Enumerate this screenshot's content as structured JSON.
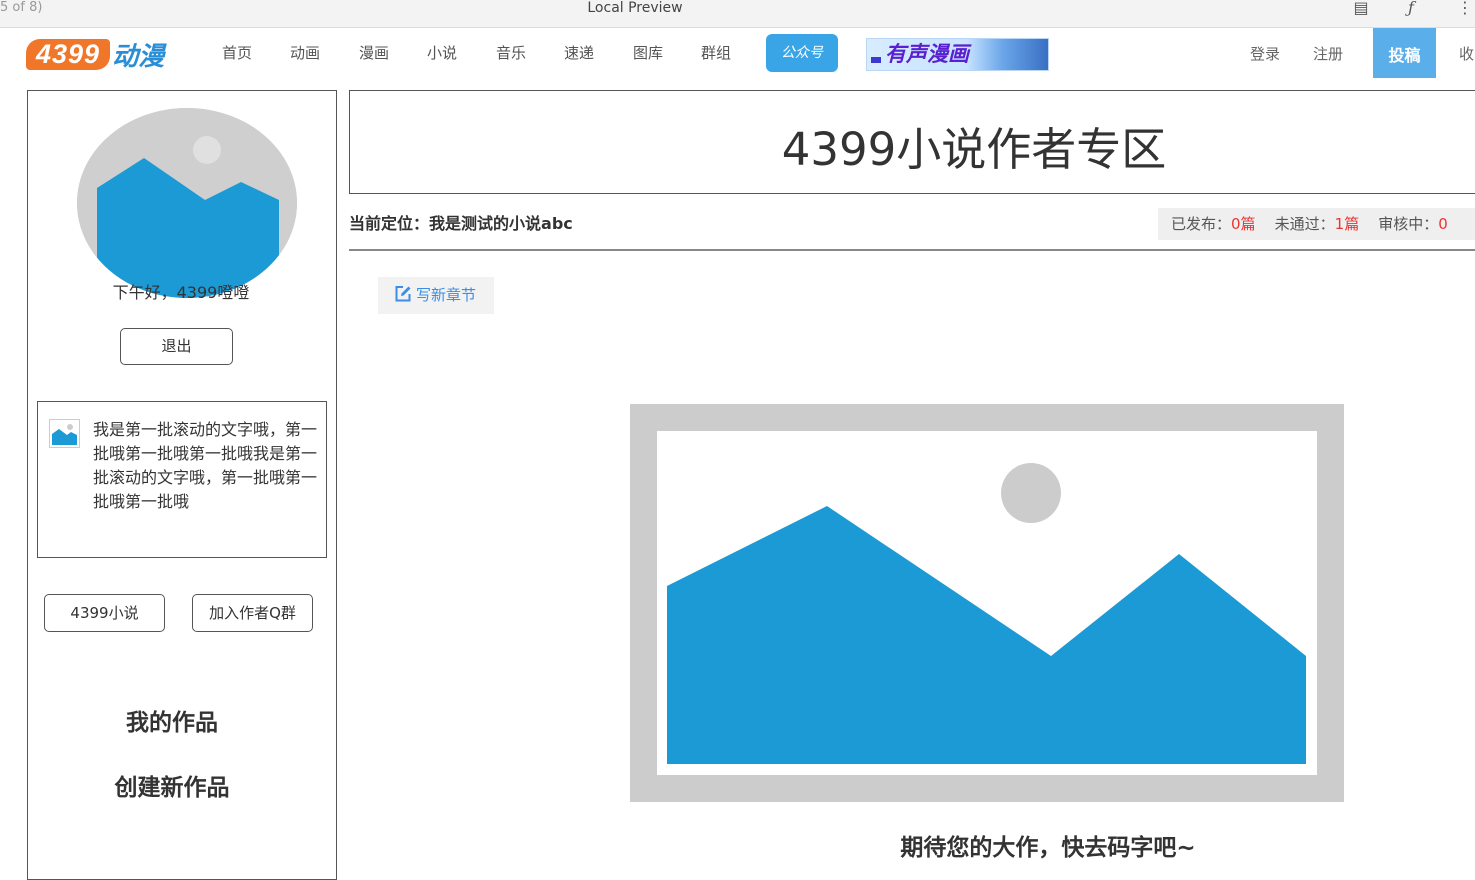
{
  "preview": {
    "page_indicator": "5 of 8)",
    "title": "Local Preview",
    "icons": [
      "document-icon",
      "formula-icon",
      "more-vertical-icon"
    ]
  },
  "nav": {
    "logo_number": "4399",
    "logo_text": "动漫",
    "items": [
      "首页",
      "动画",
      "漫画",
      "小说",
      "音乐",
      "速递",
      "图库",
      "群组"
    ],
    "wechat_badge": "公众号",
    "comic_banner": "有声漫画",
    "login": "登录",
    "register": "注册",
    "submit": "投稿",
    "favorite": "收"
  },
  "sidebar": {
    "greeting": "下午好，4399噔噔",
    "logout": "退出",
    "notice_text": "我是第一批滚动的文字哦，第一批哦第一批哦第一批哦我是第一批滚动的文字哦，第一批哦第一批哦第一批哦",
    "link_novel": "4399小说",
    "link_qq_group": "加入作者Q群",
    "my_works": "我的作品",
    "create_work": "创建新作品"
  },
  "main": {
    "title": "4399小说作者专区",
    "location_label": "当前定位：",
    "location_value": "我是测试的小说abc",
    "stats": {
      "published_label": "已发布：",
      "published_value": "0篇",
      "rejected_label": "未通过：",
      "rejected_value": "1篇",
      "reviewing_label": "审核中：",
      "reviewing_value": "0"
    },
    "write_button": "写新章节",
    "empty_text": "期待您的大作，快去码字吧~"
  },
  "colors": {
    "accent_blue": "#1b9ad5",
    "placeholder_gray": "#cccccc",
    "stat_red": "#ee3333",
    "logo_orange": "#f0772a"
  }
}
